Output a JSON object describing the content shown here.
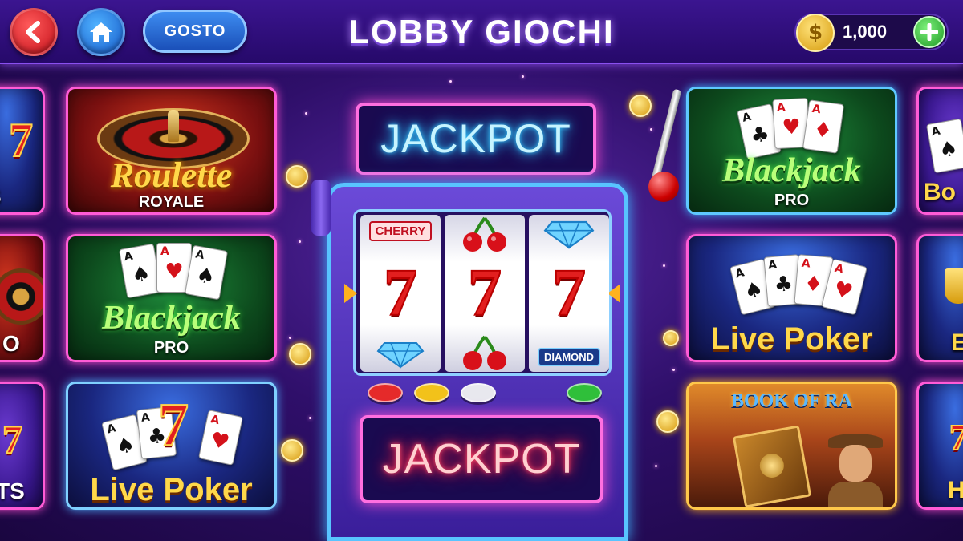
{
  "header": {
    "back_icon": "arrow-left-icon",
    "home_icon": "home-icon",
    "pill_label": "GOSTO",
    "title": "LOBBY GIOCHI",
    "coin_symbol": "$",
    "coin_balance": "1,000",
    "add_coins_icon": "plus-icon"
  },
  "left_column": [
    {
      "title": "Roulette",
      "subtitle": "ROYALE",
      "theme": "roulette"
    },
    {
      "title": "Blackjack",
      "subtitle": "PRO",
      "theme": "blackjack"
    },
    {
      "title": "Live Poker",
      "subtitle": "",
      "theme": "poker"
    }
  ],
  "right_column": [
    {
      "title": "Blackjack",
      "subtitle": "PRO",
      "theme": "blackjack"
    },
    {
      "title": "Live Poker",
      "subtitle": "",
      "theme": "poker"
    },
    {
      "title": "BOOK OF RA",
      "subtitle": "",
      "theme": "book-of-ra"
    }
  ],
  "edge_left_fragments": [
    "7",
    "S",
    "O",
    "TS"
  ],
  "edge_right_fragments": [
    "Bo",
    "E",
    "H"
  ],
  "slot_machine": {
    "top_sign": "JACKPOT",
    "bottom_sign": "JACKPOT",
    "reel_top_symbols": [
      "CHERRY",
      "cherry-icon",
      "diamond-icon"
    ],
    "reel_center": [
      "7",
      "7",
      "7"
    ],
    "reel_bottom_symbols": [
      "diamond-icon",
      "cherry-icon",
      "DIAMOND"
    ],
    "buttons": [
      {
        "name": "red-button",
        "color": "#e52a2a"
      },
      {
        "name": "yellow-button",
        "color": "#f2c21a"
      },
      {
        "name": "white-button",
        "color": "#e8e8ee"
      },
      {
        "name": "green-button",
        "color": "#2fbf3a"
      }
    ]
  },
  "colors": {
    "accent_pink": "#ff5bd6",
    "accent_blue": "#58c4ff",
    "background": "#2f0f6a",
    "gold": "#ffd54a"
  }
}
